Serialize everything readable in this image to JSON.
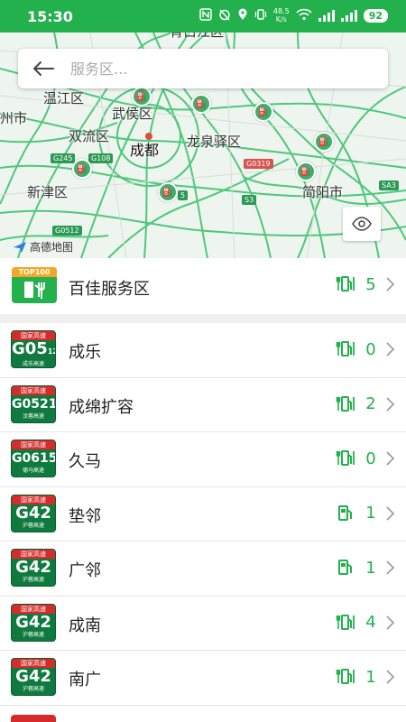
{
  "status_bar": {
    "time": "15:30",
    "net_speed_value": "48.5",
    "net_speed_unit": "K/s",
    "battery": "92"
  },
  "search": {
    "placeholder": "服务区..."
  },
  "map": {
    "labels": {
      "wenjiang": "温江区",
      "wuhou": "武侯区",
      "shuangliu": "双流区",
      "chengdu": "成都",
      "longquanyi": "龙泉驿区",
      "xinjin": "新津区",
      "jianyang": "简阳市",
      "zhou_partial": "州市",
      "top_partial": "青白江区"
    },
    "road_badges": {
      "g245": "G245",
      "g108": "G108",
      "g0319": "G0319",
      "s3": "S3",
      "sa3": "SA3",
      "g0512": "G0512",
      "s5": "5"
    },
    "logo_text": "高德地图"
  },
  "featured": {
    "badge_tag": "TOP100",
    "name": "百佳服务区",
    "count": "5"
  },
  "highways": [
    {
      "top": "国家高速",
      "code": "G05",
      "code_suffix": "12",
      "sub": "成乐高速",
      "name": "成乐",
      "count": "0"
    },
    {
      "top": "国家高速",
      "code": "G0521",
      "code_suffix": "",
      "sub": "汶蓉高速",
      "name": "成绵扩容",
      "count": "2"
    },
    {
      "top": "国家高速",
      "code": "G0615",
      "code_suffix": "",
      "sub": "德马高速",
      "name": "久马",
      "count": "0"
    },
    {
      "top": "国家高速",
      "code": "G42",
      "code_suffix": "",
      "sub": "沪蓉高速",
      "name": "垫邻",
      "count": "1"
    },
    {
      "top": "国家高速",
      "code": "G42",
      "code_suffix": "",
      "sub": "沪蓉高速",
      "name": "广邻",
      "count": "1"
    },
    {
      "top": "国家高速",
      "code": "G42",
      "code_suffix": "",
      "sub": "沪蓉高速",
      "name": "成南",
      "count": "4"
    },
    {
      "top": "国家高速",
      "code": "G42",
      "code_suffix": "",
      "sub": "沪蓉高速",
      "name": "南广",
      "count": "1"
    }
  ],
  "colors": {
    "brand_green": "#22b14c",
    "shield_green": "#0f7a3e",
    "shield_red": "#d62b2b",
    "top_badge_orange": "#f5a623"
  }
}
